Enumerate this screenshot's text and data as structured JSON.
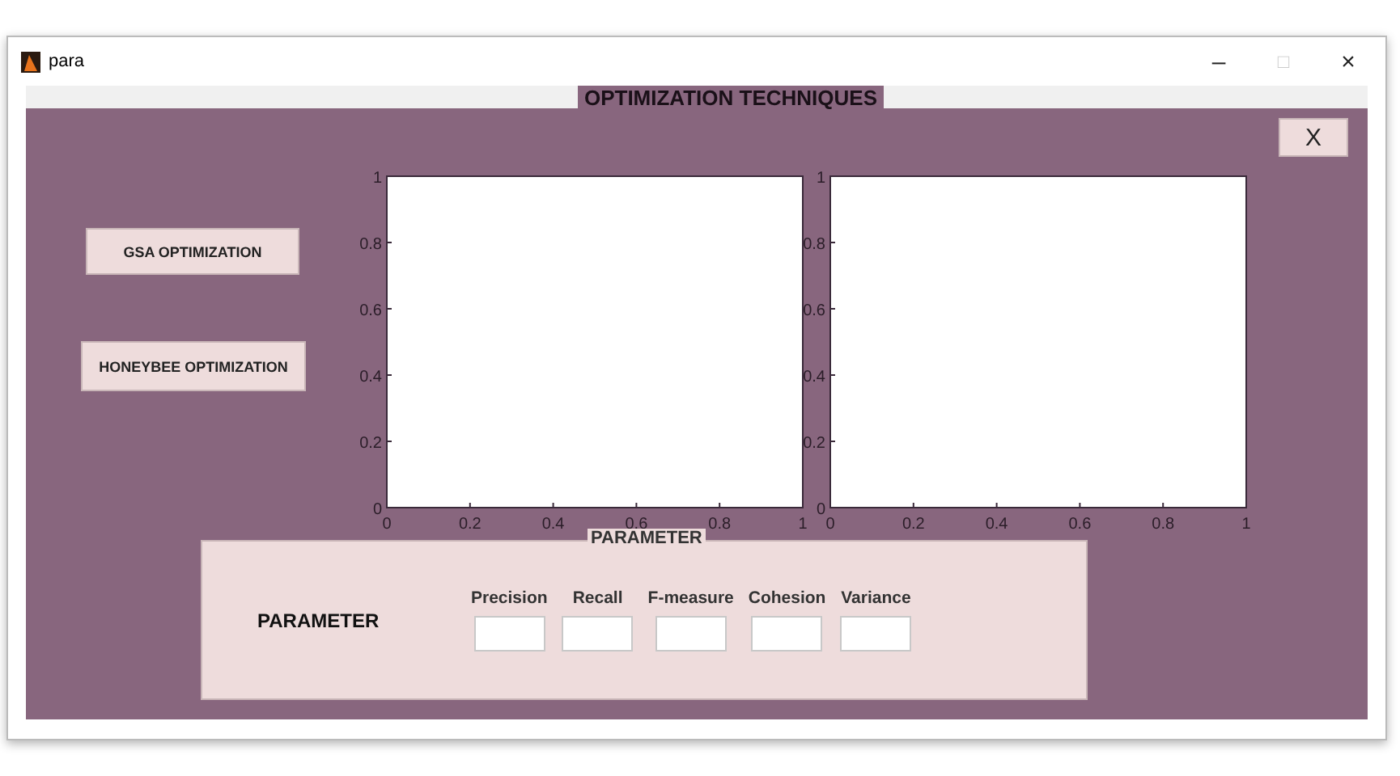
{
  "window": {
    "title": "para",
    "controls": [
      "–",
      "□",
      "×"
    ]
  },
  "figure_title": "OPTIMIZATION TECHNIQUES",
  "close_button": "X",
  "buttons": [
    "GSA OPTIMIZATION",
    "HONEYBEE OPTIMIZATION"
  ],
  "charts": [
    {
      "chart_data": {
        "type": "line",
        "xlim": [
          0,
          1
        ],
        "ylim": [
          0,
          1
        ],
        "xticks": [
          {
            "value": 0,
            "label": "0"
          },
          {
            "value": 0.2,
            "label": "0.2"
          },
          {
            "value": 0.4,
            "label": "0.4"
          },
          {
            "value": 0.6,
            "label": "0.6"
          },
          {
            "value": 0.8,
            "label": "0.8"
          },
          {
            "value": 1,
            "label": "1"
          }
        ],
        "yticks": [
          {
            "value": 0,
            "label": "0"
          },
          {
            "value": 0.2,
            "label": "0.2"
          },
          {
            "value": 0.4,
            "label": "0.4"
          },
          {
            "value": 0.6,
            "label": "0.6"
          },
          {
            "value": 0.8,
            "label": "0.8"
          },
          {
            "value": 1,
            "label": "1"
          }
        ]
      }
    },
    {
      "chart_data": {
        "type": "line",
        "xlim": [
          0,
          1
        ],
        "ylim": [
          0,
          1
        ],
        "xticks": [
          {
            "value": 0,
            "label": "0"
          },
          {
            "value": 0.2,
            "label": "0.2"
          },
          {
            "value": 0.4,
            "label": "0.4"
          },
          {
            "value": 0.6,
            "label": "0.6"
          },
          {
            "value": 0.8,
            "label": "0.8"
          },
          {
            "value": 1,
            "label": "1"
          }
        ],
        "yticks": [
          {
            "value": 0,
            "label": "0"
          },
          {
            "value": 0.2,
            "label": "0.2"
          },
          {
            "value": 0.4,
            "label": "0.4"
          },
          {
            "value": 0.6,
            "label": "0.6"
          },
          {
            "value": 0.8,
            "label": "0.8"
          },
          {
            "value": 1,
            "label": "1"
          }
        ]
      }
    }
  ],
  "parameter_panel": {
    "title": "PARAMETER",
    "label": "PARAMETER",
    "fields": [
      {
        "label": "Precision"
      },
      {
        "label": "Recall"
      },
      {
        "label": "F-measure"
      },
      {
        "label": "Cohesion"
      },
      {
        "label": "Variance"
      }
    ]
  }
}
